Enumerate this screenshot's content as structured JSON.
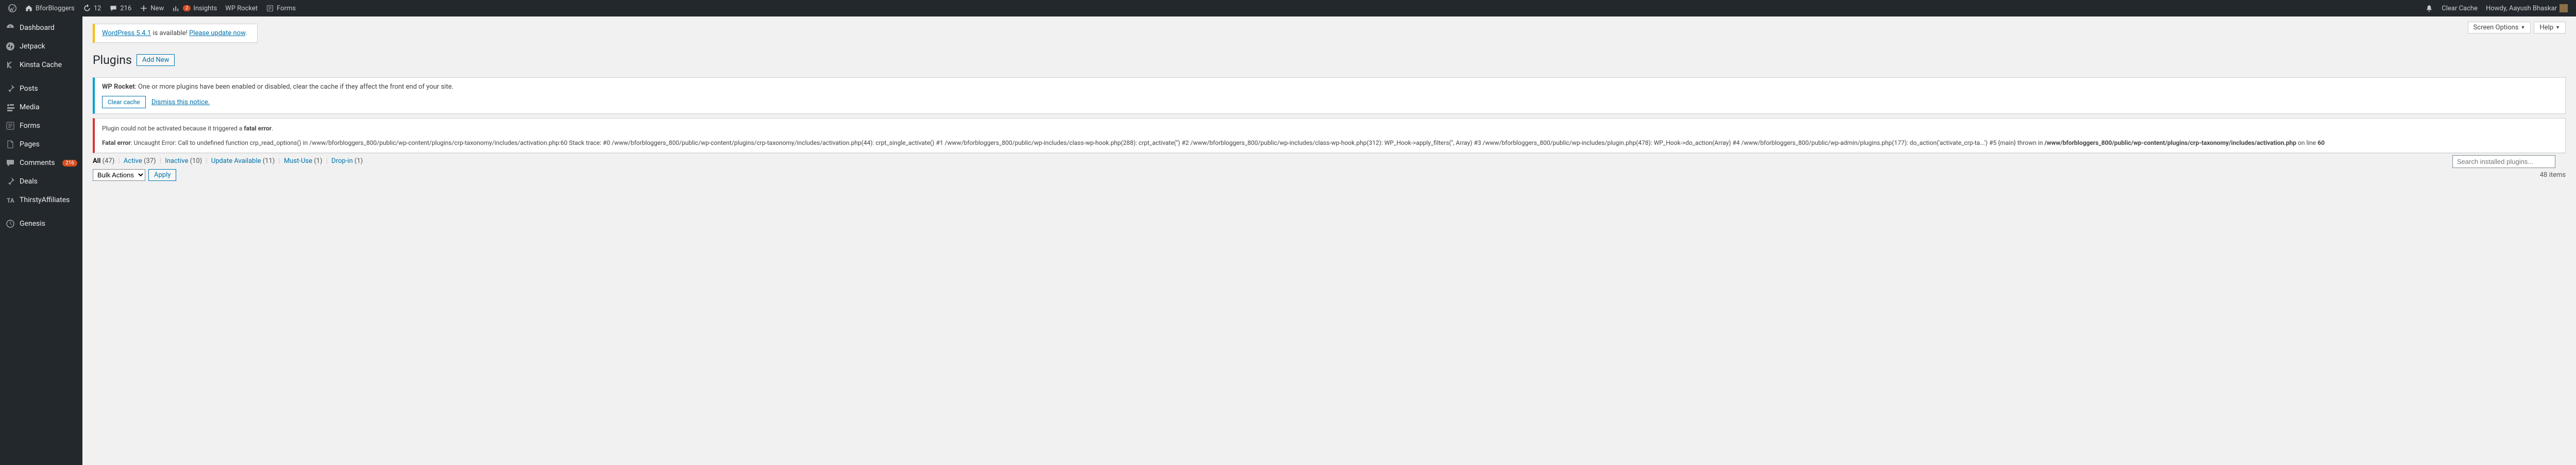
{
  "adminbar": {
    "site": "BforBloggers",
    "updates": "12",
    "comments": "216",
    "new_label": "New",
    "insights_label": "Insights",
    "insights_badge": "2",
    "wprocket_label": "WP Rocket",
    "forms_label": "Forms",
    "clear_cache": "Clear Cache",
    "howdy": "Howdy, Aayush Bhaskar"
  },
  "sidebar": {
    "items": [
      {
        "icon": "dashboard",
        "label": "Dashboard"
      },
      {
        "icon": "jetpack",
        "label": "Jetpack"
      },
      {
        "icon": "kinsta",
        "label": "Kinsta Cache"
      },
      {
        "icon": "pin",
        "label": "Posts"
      },
      {
        "icon": "media",
        "label": "Media"
      },
      {
        "icon": "forms",
        "label": "Forms"
      },
      {
        "icon": "page",
        "label": "Pages"
      },
      {
        "icon": "comments",
        "label": "Comments",
        "count": "216"
      },
      {
        "icon": "deals",
        "label": "Deals"
      },
      {
        "icon": "ta",
        "label": "ThirstyAffiliates"
      },
      {
        "icon": "genesis",
        "label": "Genesis"
      }
    ]
  },
  "update_notice": {
    "link1": "WordPress 5.4.1",
    "text": " is available! ",
    "link2": "Please update now",
    "suffix": "."
  },
  "page": {
    "title": "Plugins",
    "add_new": "Add New"
  },
  "rocket_notice": {
    "bold": "WP Rocket",
    "text": ": One or more plugins have been enabled or disabled, clear the cache if they affect the front end of your site.",
    "clear": "Clear cache",
    "dismiss": "Dismiss this notice."
  },
  "error_notice": {
    "line1_pre": "Plugin could not be activated because it triggered a ",
    "line1_bold": "fatal error",
    "line1_suffix": ".",
    "fatal_label": "Fatal error",
    "trace": ": Uncaught Error: Call to undefined function crp_read_options() in /www/bforbloggers_800/public/wp-content/plugins/crp-taxonomy/includes/activation.php:60 Stack trace: #0 /www/bforbloggers_800/public/wp-content/plugins/crp-taxonomy/includes/activation.php(44): crpt_single_activate() #1 /www/bforbloggers_800/public/wp-includes/class-wp-hook.php(288): crpt_activate('') #2 /www/bforbloggers_800/public/wp-includes/class-wp-hook.php(312): WP_Hook->apply_filters('', Array) #3 /www/bforbloggers_800/public/wp-includes/plugin.php(478): WP_Hook->do_action(Array) #4 /www/bforbloggers_800/public/wp-admin/plugins.php(177): do_action('activate_crp-ta...') #5 {main} thrown in ",
    "path": "/www/bforbloggers_800/public/wp-content/plugins/crp-taxonomy/includes/activation.php",
    "online": " on line ",
    "line": "60"
  },
  "filters": {
    "all": "All",
    "all_c": "(47)",
    "active": "Active",
    "active_c": "(37)",
    "inactive": "Inactive",
    "inactive_c": "(10)",
    "update": "Update Available",
    "update_c": "(11)",
    "mustuse": "Must-Use",
    "mustuse_c": "(1)",
    "dropin": "Drop-in",
    "dropin_c": "(1)"
  },
  "bulk": {
    "label": "Bulk Actions",
    "apply": "Apply"
  },
  "search": {
    "placeholder": "Search installed plugins..."
  },
  "items_count": "48 items",
  "topbuttons": {
    "screen": "Screen Options",
    "help": "Help"
  }
}
